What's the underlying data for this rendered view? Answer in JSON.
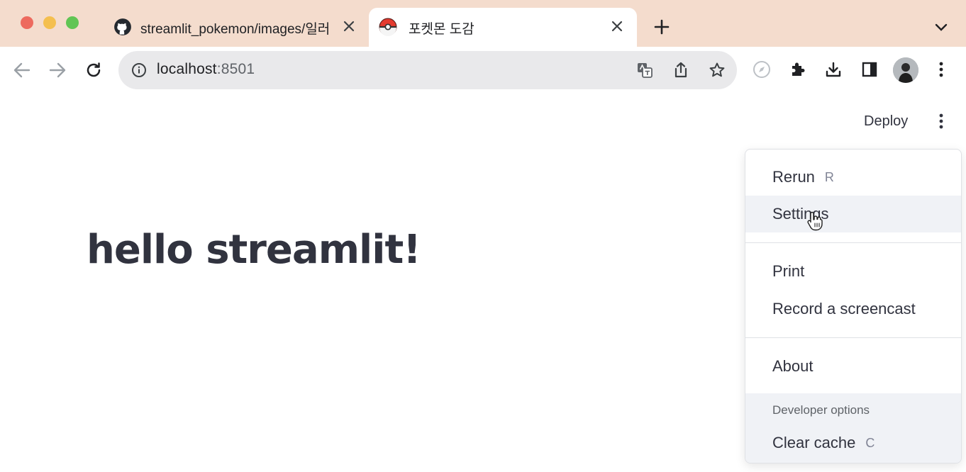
{
  "window": {
    "controls": [
      "close",
      "minimize",
      "maximize"
    ]
  },
  "tabs": [
    {
      "title": "streamlit_pokemon/images/일러",
      "favicon": "github-icon",
      "active": false
    },
    {
      "title": "포켓몬 도감",
      "favicon": "pokeball-icon",
      "active": true
    }
  ],
  "address_bar": {
    "host": "localhost",
    "port": ":8501"
  },
  "app": {
    "deploy_label": "Deploy",
    "heading": "hello streamlit!"
  },
  "menu": {
    "items": [
      {
        "label": "Rerun",
        "shortcut": "R"
      },
      {
        "label": "Settings",
        "shortcut": ""
      },
      {
        "label": "Print",
        "shortcut": ""
      },
      {
        "label": "Record a screencast",
        "shortcut": ""
      },
      {
        "label": "About",
        "shortcut": ""
      }
    ],
    "developer_label": "Developer options",
    "developer_items": [
      {
        "label": "Clear cache",
        "shortcut": "C"
      }
    ],
    "hovered_item": "Settings"
  },
  "colors": {
    "tabstrip_bg": "#f4dccd",
    "text_primary": "#31333f",
    "menu_hover_bg": "#f0f2f6"
  }
}
